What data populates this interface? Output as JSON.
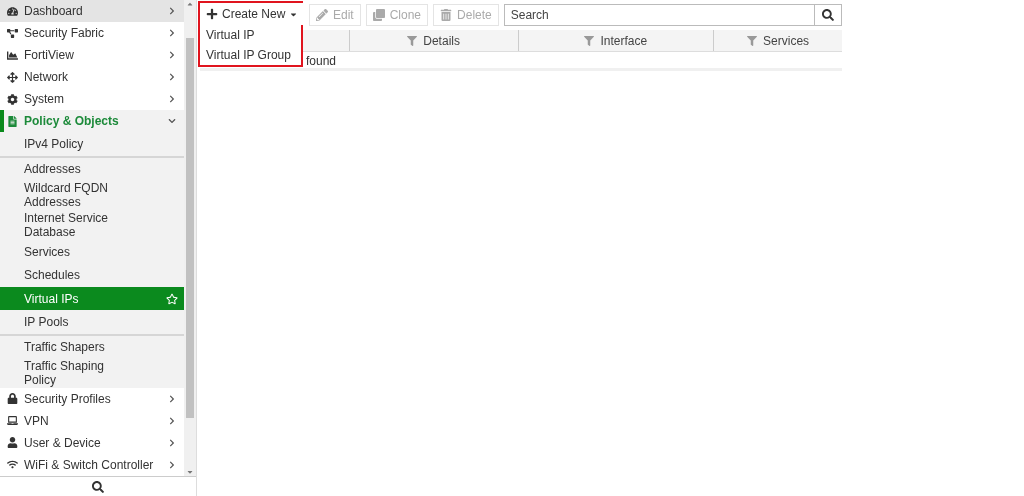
{
  "sidebar": {
    "items": [
      {
        "label": "Dashboard",
        "highlighted": true,
        "expanded": false
      },
      {
        "label": "Security Fabric",
        "highlighted": false,
        "expanded": false
      },
      {
        "label": "FortiView",
        "highlighted": false,
        "expanded": false
      },
      {
        "label": "Network",
        "highlighted": false,
        "expanded": false
      },
      {
        "label": "System",
        "highlighted": false,
        "expanded": false
      },
      {
        "label": "Policy & Objects",
        "highlighted": false,
        "expanded": true,
        "children": [
          {
            "label": "IPv4 Policy",
            "selected": false,
            "separator_before": false
          },
          {
            "label": "Addresses",
            "selected": false,
            "separator_before": true
          },
          {
            "label": "Wildcard FQDN Addresses",
            "selected": false,
            "separator_before": false
          },
          {
            "label": "Internet Service Database",
            "selected": false,
            "separator_before": false
          },
          {
            "label": "Services",
            "selected": false,
            "separator_before": false
          },
          {
            "label": "Schedules",
            "selected": false,
            "separator_before": false
          },
          {
            "label": "Virtual IPs",
            "selected": true,
            "separator_before": false
          },
          {
            "label": "IP Pools",
            "selected": false,
            "separator_before": false
          },
          {
            "label": "Traffic Shapers",
            "selected": false,
            "separator_before": true
          },
          {
            "label": "Traffic Shaping Policy",
            "selected": false,
            "separator_before": false
          }
        ]
      },
      {
        "label": "Security Profiles",
        "highlighted": false,
        "expanded": false
      },
      {
        "label": "VPN",
        "highlighted": false,
        "expanded": false
      },
      {
        "label": "User & Device",
        "highlighted": false,
        "expanded": false
      },
      {
        "label": "WiFi & Switch Controller",
        "highlighted": false,
        "expanded": false
      }
    ]
  },
  "toolbar": {
    "create": {
      "label": "Create New",
      "expanded": true,
      "menu": [
        "Virtual IP",
        "Virtual IP Group"
      ]
    },
    "buttons": [
      {
        "label": "Edit",
        "disabled": true
      },
      {
        "label": "Clone",
        "disabled": true
      },
      {
        "label": "Delete",
        "disabled": true
      }
    ],
    "search": {
      "placeholder": "Search"
    }
  },
  "table": {
    "columns": [
      "Details",
      "Interface",
      "Services"
    ],
    "empty_message": "found"
  }
}
